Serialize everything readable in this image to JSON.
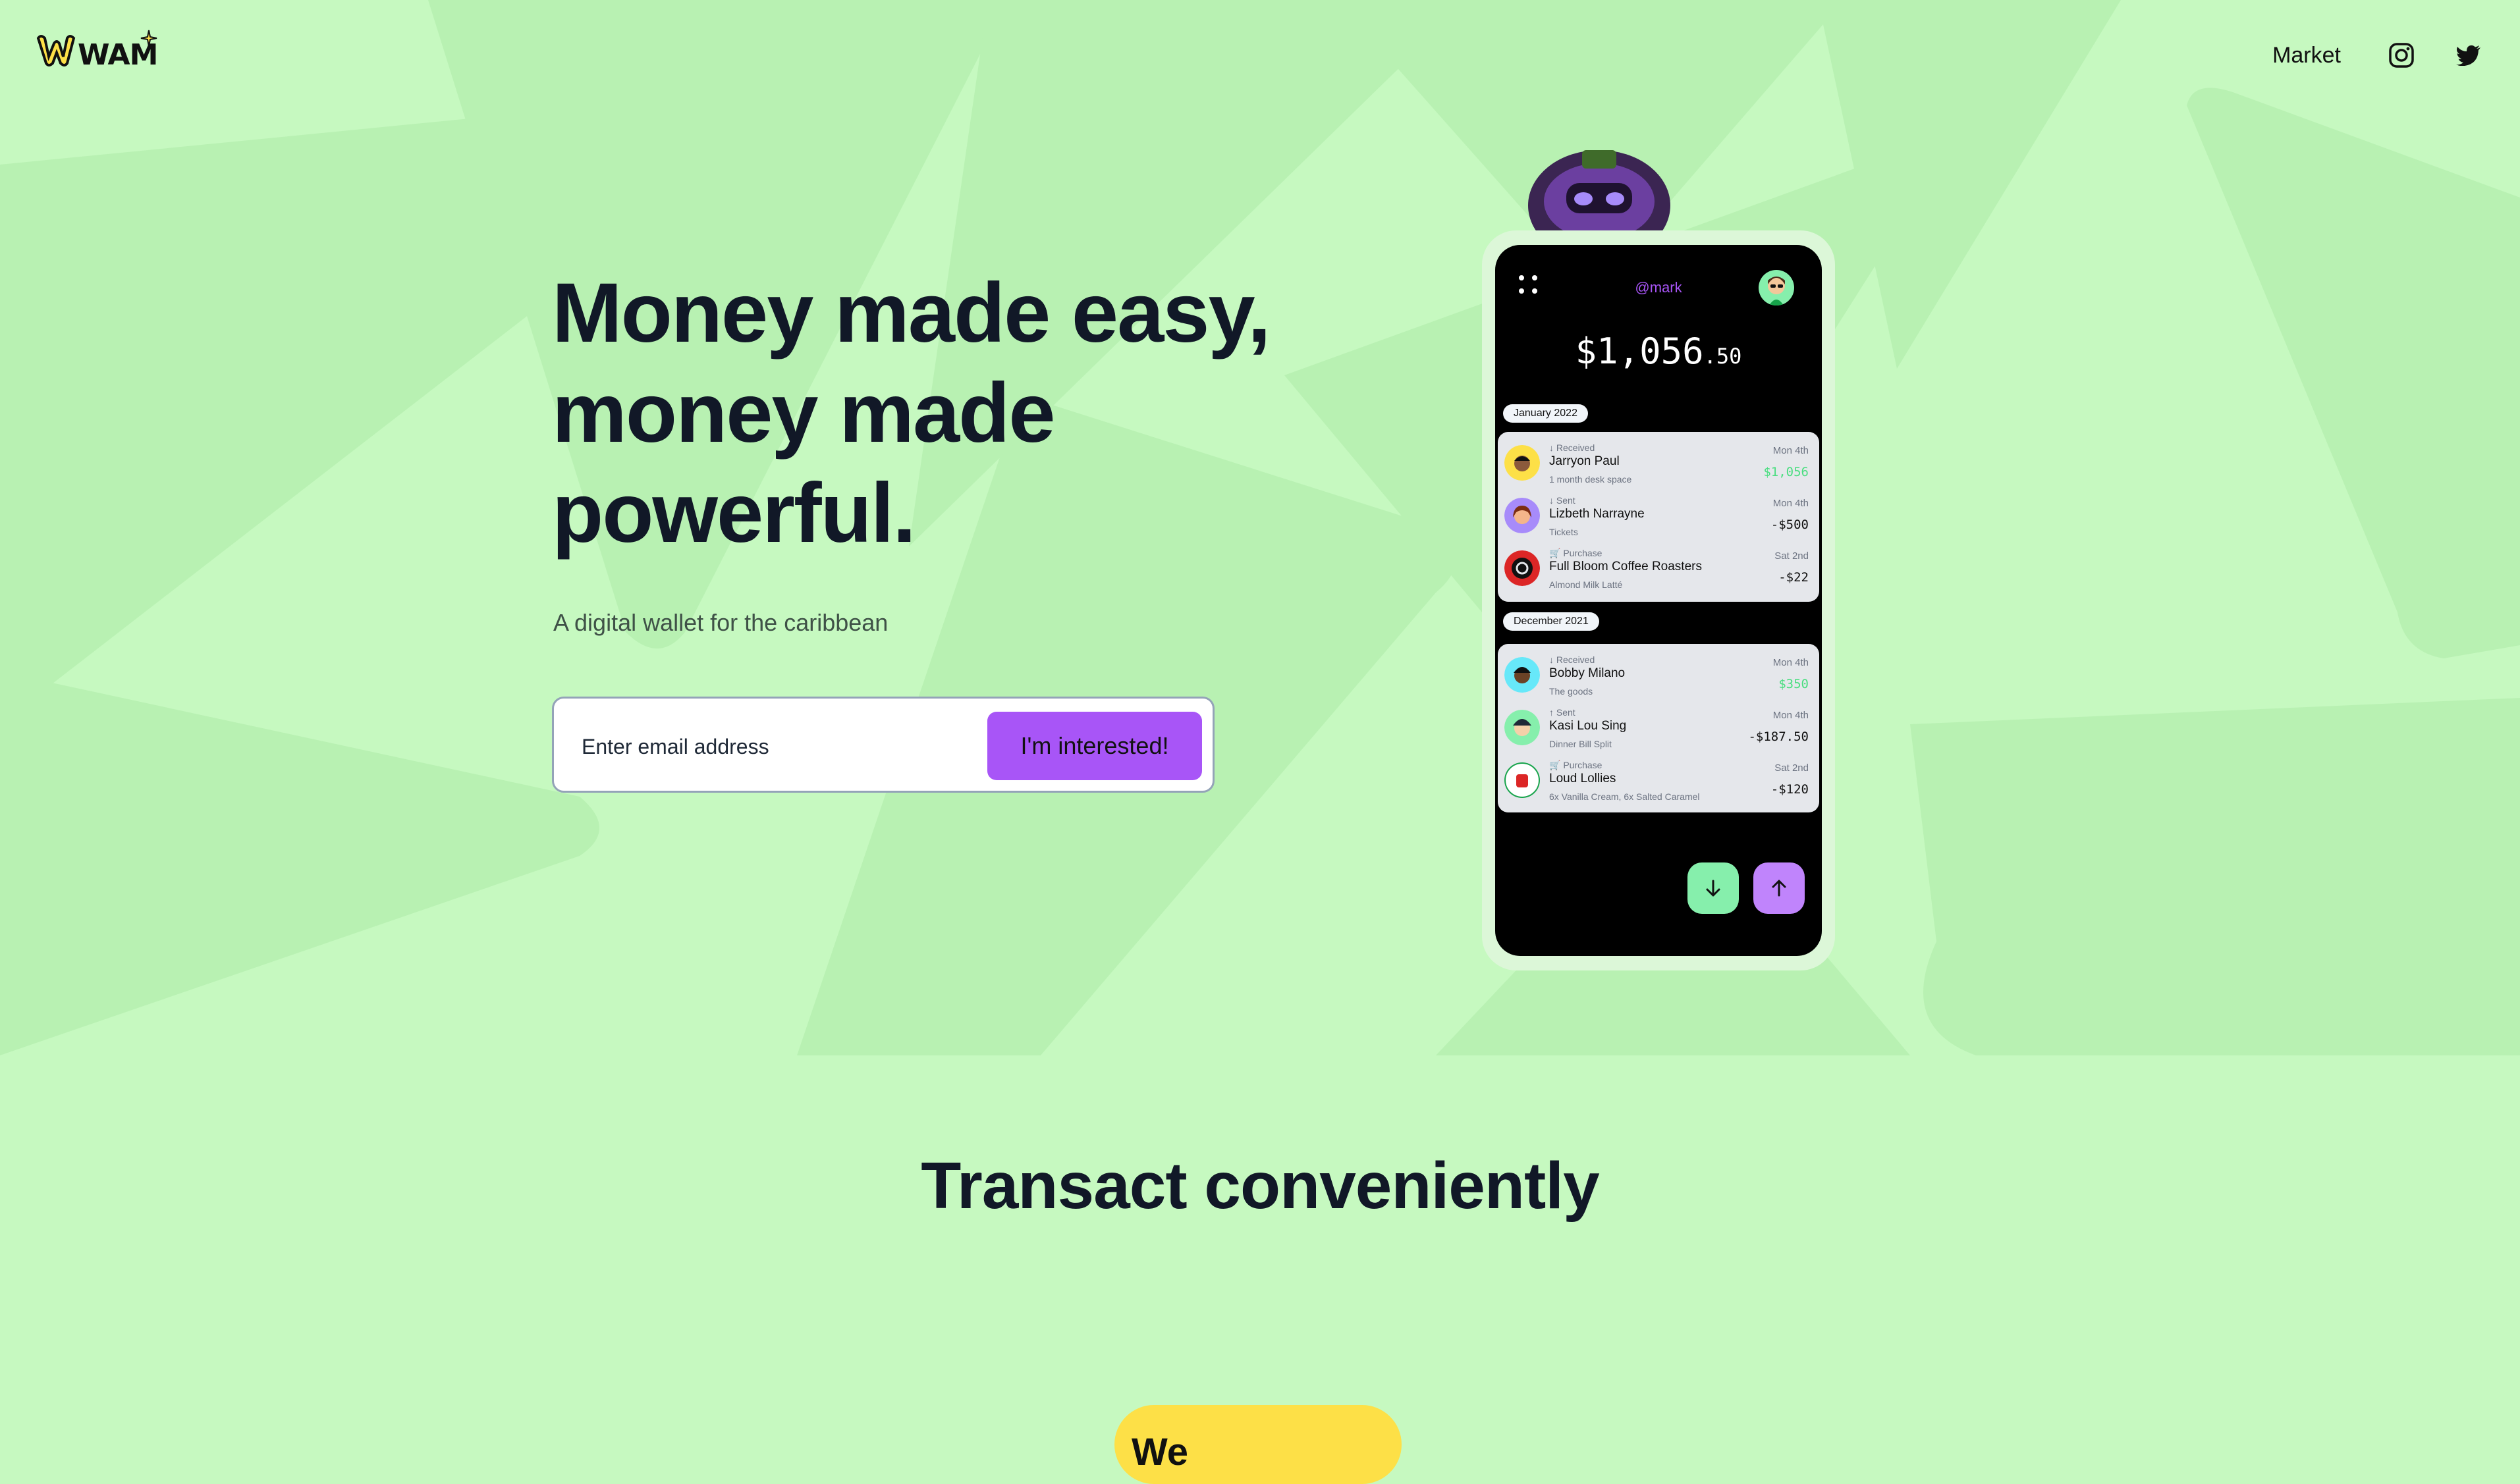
{
  "header": {
    "logo_text": "WAM",
    "nav": [
      {
        "label": "Market"
      }
    ],
    "social": [
      "instagram-icon",
      "twitter-icon"
    ]
  },
  "hero": {
    "headline": [
      "Money made easy,",
      "money made",
      "powerful."
    ],
    "subhead": "A digital wallet for the caribbean",
    "email_placeholder": "Enter email address",
    "cta_label": "I'm interested!"
  },
  "phone": {
    "handle": "@mark",
    "balance_main": "$1,056",
    "balance_cents": ".50",
    "groups": [
      {
        "month": "January 2022",
        "transactions": [
          {
            "type": "↓ Received",
            "name": "Jarryon Paul",
            "note": "1 month desk space",
            "date": "Mon 4th",
            "amount": "$1,056",
            "positive": true
          },
          {
            "type": "↓ Sent",
            "name": "Lizbeth Narrayne",
            "note": "Tickets",
            "date": "Mon 4th",
            "amount": "-$500",
            "positive": false
          },
          {
            "type": "🛒 Purchase",
            "name": "Full Bloom Coffee Roasters",
            "note": "Almond Milk Latté",
            "date": "Sat 2nd",
            "amount": "-$22",
            "positive": false
          }
        ]
      },
      {
        "month": "December 2021",
        "transactions": [
          {
            "type": "↓ Received",
            "name": "Bobby Milano",
            "note": "The goods",
            "date": "Mon 4th",
            "amount": "$350",
            "positive": true
          },
          {
            "type": "↑ Sent",
            "name": "Kasi Lou Sing",
            "note": "Dinner Bill Split",
            "date": "Mon 4th",
            "amount": "-$187.50",
            "positive": false
          },
          {
            "type": "🛒 Purchase",
            "name": "Loud Lollies",
            "note": "6x Vanilla Cream, 6x Salted Caramel",
            "date": "Sat 2nd",
            "amount": "-$120",
            "positive": false
          }
        ]
      }
    ]
  },
  "section": {
    "title": "Transact conveniently",
    "pill_text": "We"
  },
  "colors": {
    "background": "#c6f9c0",
    "accent_purple": "#a855f7",
    "accent_green": "#86efac",
    "yellow": "#fde047"
  }
}
